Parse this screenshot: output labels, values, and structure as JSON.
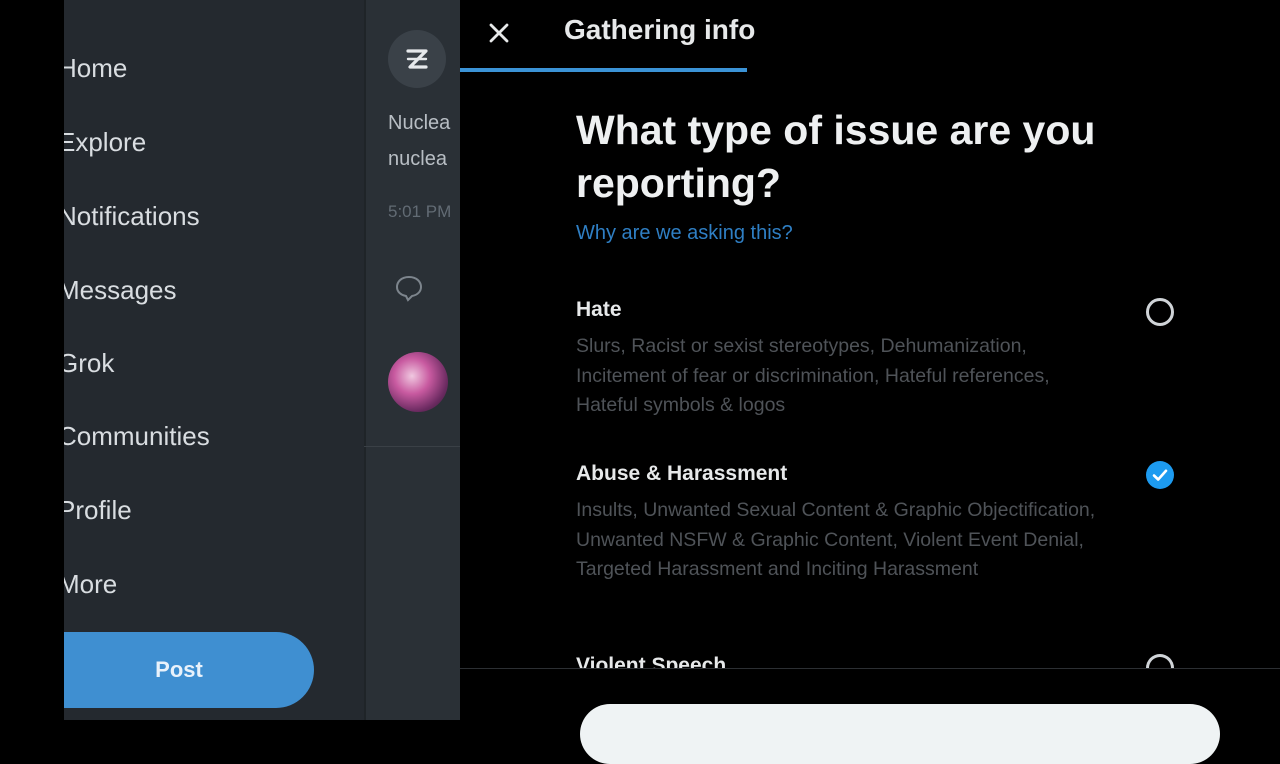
{
  "sidebar": {
    "items": [
      {
        "label": "Home"
      },
      {
        "label": "Explore"
      },
      {
        "label": "Notifications"
      },
      {
        "label": "Messages"
      },
      {
        "label": "Grok"
      },
      {
        "label": "Communities"
      },
      {
        "label": "Profile"
      },
      {
        "label": "More"
      }
    ],
    "post_label": "Post"
  },
  "feed": {
    "line1": "Nuclea",
    "line2": "nuclea",
    "time": "5:01 PM"
  },
  "modal": {
    "title": "Gathering info",
    "progress": 0.35,
    "question": "What type of issue are you reporting?",
    "why_link": "Why are we asking this?",
    "options": [
      {
        "label": "Hate",
        "description": "Slurs, Racist or sexist stereotypes, Dehumanization, Incitement of fear or discrimination, Hateful references, Hateful symbols & logos",
        "selected": false
      },
      {
        "label": "Abuse & Harassment",
        "description": "Insults, Unwanted Sexual Content & Graphic Objectification, Unwanted NSFW & Graphic Content, Violent Event Denial, Targeted Harassment and Inciting Harassment",
        "selected": true
      },
      {
        "label": "Violent Speech",
        "description": "",
        "selected": false
      }
    ]
  },
  "colors": {
    "accent": "#1d9bf0",
    "post_button": "#3f8fd1",
    "link": "#2f7fc4",
    "sidebar_bg": "#24292f",
    "modal_bg": "#000000"
  },
  "icons": {
    "close": "close-icon",
    "grok": "grok-icon",
    "reply": "reply-icon",
    "check": "check-icon"
  }
}
